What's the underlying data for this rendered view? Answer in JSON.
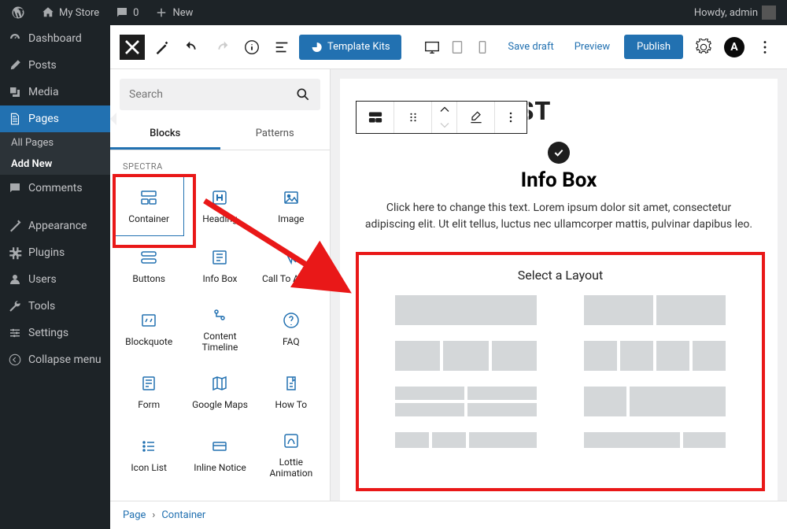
{
  "adminbar": {
    "site_name": "My Store",
    "comments": "0",
    "new_label": "New",
    "howdy": "Howdy, admin"
  },
  "sidebar": {
    "dashboard": "Dashboard",
    "posts": "Posts",
    "media": "Media",
    "pages": "Pages",
    "all_pages": "All Pages",
    "add_new": "Add New",
    "comments": "Comments",
    "appearance": "Appearance",
    "plugins": "Plugins",
    "users": "Users",
    "tools": "Tools",
    "settings": "Settings",
    "collapse": "Collapse menu"
  },
  "topbar": {
    "template_kits": "Template Kits",
    "save_draft": "Save draft",
    "preview": "Preview",
    "publish": "Publish"
  },
  "inserter": {
    "search_placeholder": "Search",
    "tab_blocks": "Blocks",
    "tab_patterns": "Patterns",
    "category": "SPECTRA",
    "blocks": [
      "Container",
      "Heading",
      "Image",
      "Buttons",
      "Info Box",
      "Call To Action",
      "Blockquote",
      "Content Timeline",
      "FAQ",
      "Form",
      "Google Maps",
      "How To",
      "Icon List",
      "Inline Notice",
      "Lottie Animation"
    ]
  },
  "canvas": {
    "page_title": "SPECTRA TEST",
    "info_box_title": "Info Box",
    "info_box_text": "Click here to change this text. Lorem ipsum dolor sit amet, consectetur adipiscing elit. Ut elit tellus, luctus nec ullamcorper mattis, pulvinar dapibus leo.",
    "select_layout": "Select a Layout"
  },
  "breadcrumb": {
    "page": "Page",
    "container": "Container"
  }
}
